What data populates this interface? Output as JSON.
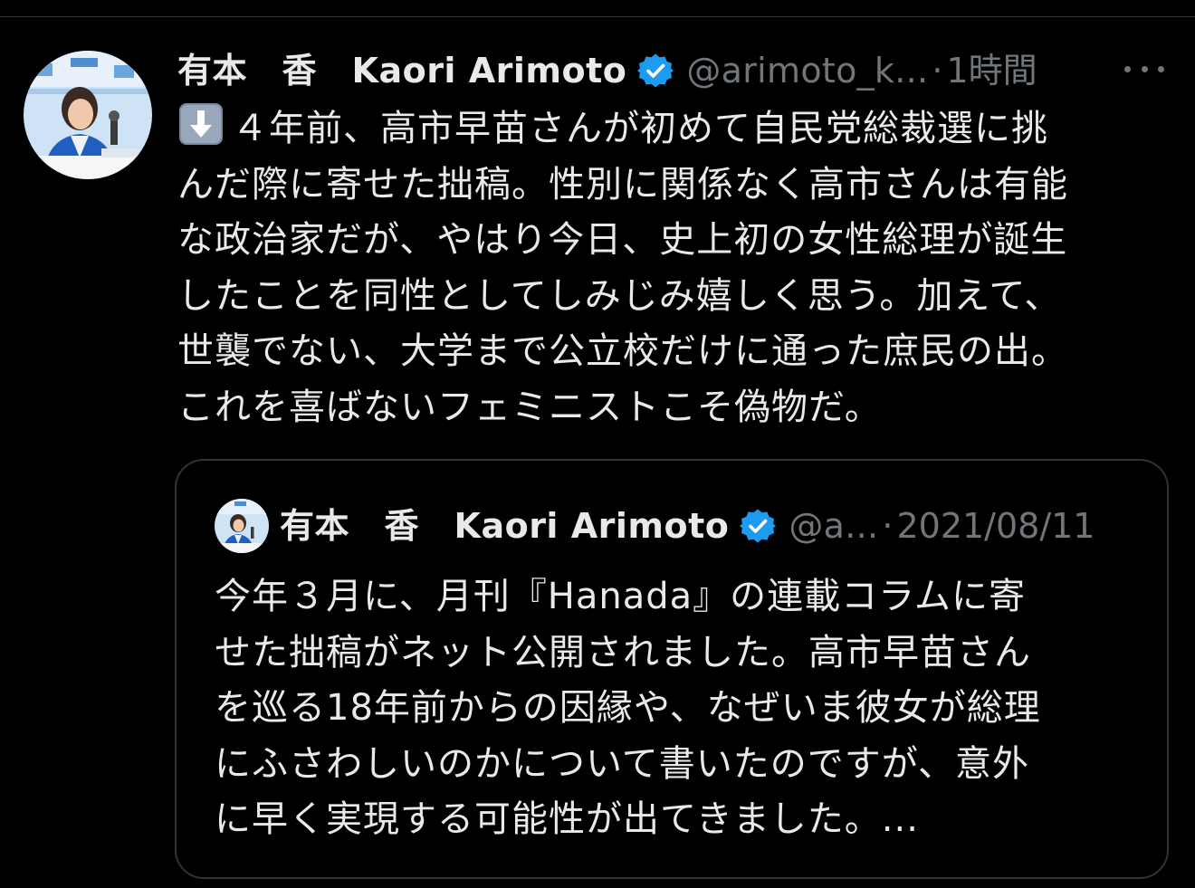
{
  "colors": {
    "background": "#000000",
    "text_primary": "#e7e9ea",
    "text_secondary": "#71767b",
    "verified_blue": "#1d9bf0",
    "border": "#2f3336"
  },
  "tweet": {
    "author_name": "有本　香　Kaori Arimoto",
    "handle": "@arimoto_k...",
    "separator": "·",
    "time": "1時間",
    "verified_icon": "verified-badge-icon",
    "more_icon": "more-options-icon",
    "emoji_icon": "down-arrow-emoji-icon",
    "text_lines": [
      "４年前、高市早苗さんが初めて自民党総裁選に挑",
      "んだ際に寄せた拙稿。性別に関係なく高市さんは有能",
      "な政治家だが、やはり今日、史上初の女性総理が誕生",
      "したことを同性としてしみじみ嬉しく思う。加えて、",
      "世襲でない、大学まで公立校だけに通った庶民の出。",
      "これを喜ばないフェミニストこそ偽物だ。"
    ]
  },
  "quoted_tweet": {
    "author_name": "有本　香　Kaori Arimoto",
    "handle": "@a...",
    "separator": "·",
    "date": "2021/08/11",
    "verified_icon": "verified-badge-icon",
    "text_lines": [
      "今年３月に、月刊『Hanada』の連載コラムに寄",
      "せた拙稿がネット公開されました。高市早苗さん",
      "を巡る18年前からの因縁や、なぜいま彼女が総理",
      "にふさわしいのかについて書いたのですが、意外",
      "に早く実現する可能性が出てきました。..."
    ]
  }
}
